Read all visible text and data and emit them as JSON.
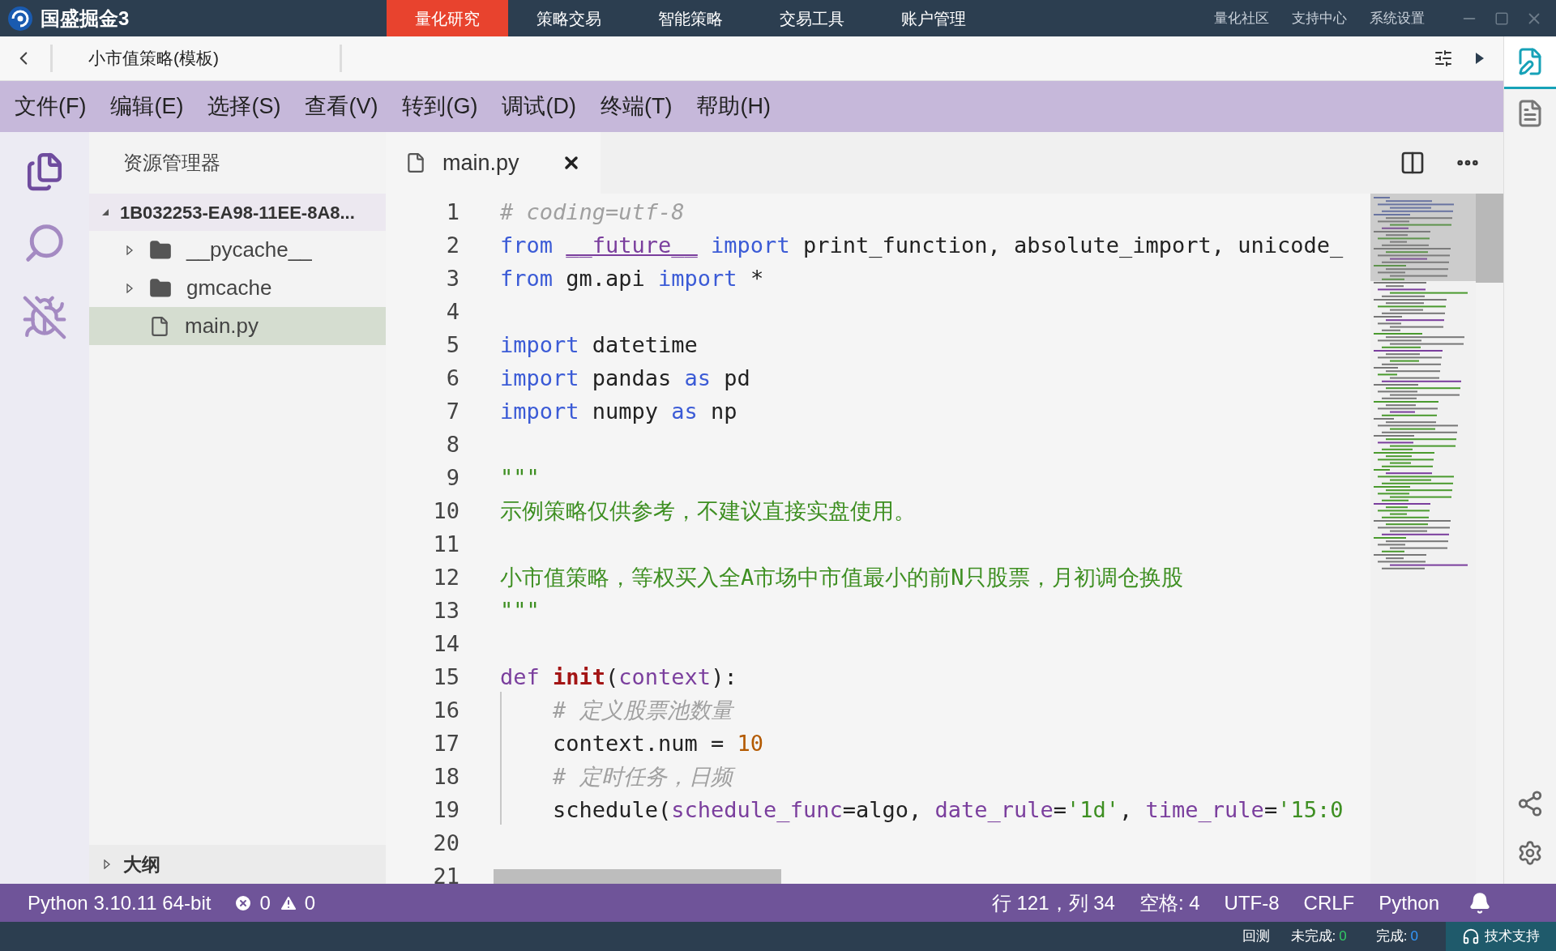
{
  "app": {
    "title": "国盛掘金3"
  },
  "nav_tabs": [
    {
      "label": "量化研究",
      "selected": true
    },
    {
      "label": "策略交易",
      "selected": false
    },
    {
      "label": "智能策略",
      "selected": false
    },
    {
      "label": "交易工具",
      "selected": false
    },
    {
      "label": "账户管理",
      "selected": false
    }
  ],
  "top_links": [
    "量化社区",
    "支持中心",
    "系统设置"
  ],
  "breadcrumb": {
    "title": "小市值策略(模板)"
  },
  "menu": [
    "文件(F)",
    "编辑(E)",
    "选择(S)",
    "查看(V)",
    "转到(G)",
    "调试(D)",
    "终端(T)",
    "帮助(H)"
  ],
  "explorer": {
    "title": "资源管理器",
    "root": {
      "label": "1B032253-EA98-11EE-8A8...",
      "expanded": true,
      "children": [
        {
          "label": "__pycache__",
          "kind": "folder",
          "expanded": false,
          "selected": false
        },
        {
          "label": "gmcache",
          "kind": "folder",
          "expanded": false,
          "selected": false
        },
        {
          "label": "main.py",
          "kind": "file",
          "selected": true
        }
      ]
    },
    "outline": {
      "label": "大纲",
      "expanded": false
    }
  },
  "editor_tab": {
    "label": "main.py"
  },
  "code": [
    {
      "number": "1",
      "tokens": [
        {
          "text": "# coding=utf-8",
          "kind": "comment"
        }
      ]
    },
    {
      "number": "2",
      "tokens": [
        {
          "text": "from ",
          "kind": "keyword"
        },
        {
          "text": "__future__",
          "kind": "dunder"
        },
        {
          "text": " import",
          "kind": "keyword"
        },
        {
          "text": " print_function, absolute_import, unicode_",
          "kind": "plain"
        }
      ]
    },
    {
      "number": "3",
      "tokens": [
        {
          "text": "from",
          "kind": "keyword"
        },
        {
          "text": " gm.api ",
          "kind": "plain"
        },
        {
          "text": "import",
          "kind": "keyword"
        },
        {
          "text": " *",
          "kind": "plain"
        }
      ]
    },
    {
      "number": "4"
    },
    {
      "number": "5",
      "tokens": [
        {
          "text": "import",
          "kind": "keyword"
        },
        {
          "text": " datetime",
          "kind": "plain"
        }
      ]
    },
    {
      "number": "6",
      "tokens": [
        {
          "text": "import",
          "kind": "keyword"
        },
        {
          "text": " pandas ",
          "kind": "plain"
        },
        {
          "text": "as",
          "kind": "keyword"
        },
        {
          "text": " pd",
          "kind": "plain"
        }
      ]
    },
    {
      "number": "7",
      "tokens": [
        {
          "text": "import",
          "kind": "keyword"
        },
        {
          "text": " numpy ",
          "kind": "plain"
        },
        {
          "text": "as",
          "kind": "keyword"
        },
        {
          "text": " np",
          "kind": "plain"
        }
      ]
    },
    {
      "number": "8"
    },
    {
      "number": "9",
      "tokens": [
        {
          "text": "\"\"\"",
          "kind": "docstring"
        }
      ]
    },
    {
      "number": "10",
      "tokens": [
        {
          "text": "示例策略仅供参考，不建议直接实盘使用。",
          "kind": "docstring"
        }
      ]
    },
    {
      "number": "11"
    },
    {
      "number": "12",
      "tokens": [
        {
          "text": "小市值策略，等权买入全A市场中市值最小的前N只股票，月初调仓换股",
          "kind": "docstring"
        }
      ]
    },
    {
      "number": "13",
      "tokens": [
        {
          "text": "\"\"\"",
          "kind": "docstring"
        }
      ]
    },
    {
      "number": "14"
    },
    {
      "number": "15",
      "tokens": [
        {
          "text": "def ",
          "kind": "def"
        },
        {
          "text": "init",
          "kind": "func"
        },
        {
          "text": "(",
          "kind": "plain"
        },
        {
          "text": "context",
          "kind": "param"
        },
        {
          "text": "):",
          "kind": "plain"
        }
      ]
    },
    {
      "number": "16",
      "indent_guide": true,
      "tokens": [
        {
          "text": "    # 定义股票池数量",
          "kind": "comment"
        }
      ]
    },
    {
      "number": "17",
      "indent_guide": true,
      "tokens": [
        {
          "text": "    context.num = ",
          "kind": "plain"
        },
        {
          "text": "10",
          "kind": "number"
        }
      ]
    },
    {
      "number": "18",
      "indent_guide": true,
      "tokens": [
        {
          "text": "    # 定时任务，日频",
          "kind": "comment"
        }
      ]
    },
    {
      "number": "19",
      "indent_guide": true,
      "tokens": [
        {
          "text": "    schedule(",
          "kind": "plain"
        },
        {
          "text": "schedule_func",
          "kind": "param"
        },
        {
          "text": "=algo, ",
          "kind": "plain"
        },
        {
          "text": "date_rule",
          "kind": "param"
        },
        {
          "text": "=",
          "kind": "plain"
        },
        {
          "text": "'1d'",
          "kind": "string"
        },
        {
          "text": ", ",
          "kind": "plain"
        },
        {
          "text": "time_rule",
          "kind": "param"
        },
        {
          "text": "=",
          "kind": "plain"
        },
        {
          "text": "'15:0",
          "kind": "string"
        }
      ]
    },
    {
      "number": "20"
    },
    {
      "number": "21"
    }
  ],
  "status_bar": {
    "interpreter": "Python 3.10.11 64-bit",
    "errors": "0",
    "warnings": "0",
    "position": "行 121，列 34",
    "spaces": "空格: 4",
    "encoding": "UTF-8",
    "eol": "CRLF",
    "language": "Python"
  },
  "bottom_bar": {
    "backtest": "回测",
    "pending_label": "未完成:",
    "pending": "0",
    "done_label": "完成:",
    "done": "0",
    "support": "技术支持"
  }
}
